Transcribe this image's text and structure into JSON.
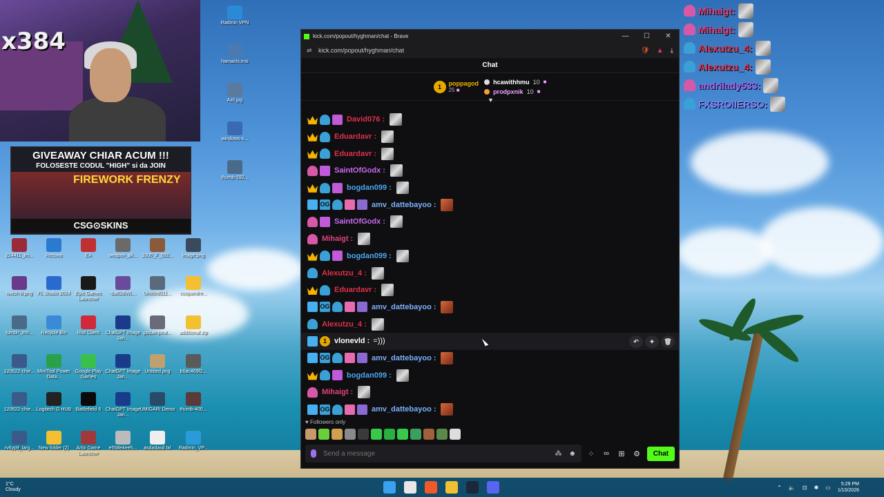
{
  "stream_overlay": {
    "counter": "x384",
    "giveaway_line1": "GIVEAWAY CHIAR ACUM !!!",
    "giveaway_line2": "FOLOSESTE CODUL \"HIGH\" si da JOIN",
    "giveaway_game": "FIREWORK FRENZY",
    "giveaway_sponsor": "CSG⊙SKINS",
    "chat": [
      {
        "user": "Mihaigt:",
        "color": "#e0407a"
      },
      {
        "user": "Mihaigt:",
        "color": "#e0407a"
      },
      {
        "user": "Alexutzu_4:",
        "color": "#e0304a"
      },
      {
        "user": "Alexutzu_4:",
        "color": "#e0304a"
      },
      {
        "user": "andrilady533:",
        "color": "#a060f0"
      },
      {
        "user": "FXSROIIERSO:",
        "color": "#8080ff"
      }
    ]
  },
  "desktop_icons": [
    {
      "label": "Radmin VPN"
    },
    {
      "label": "hamachi.msi"
    },
    {
      "label": "Azil.jpg"
    },
    {
      "label": "windows-x..."
    },
    {
      "label": "thumb-192..."
    },
    {
      "label": "224411_im..."
    },
    {
      "label": "Recuva"
    },
    {
      "label": "EA"
    },
    {
      "label": "weapon_ak..."
    },
    {
      "label": "1000_F_592..."
    },
    {
      "label": "image.png"
    },
    {
      "label": "twitch-b.png"
    },
    {
      "label": "FL Studio 2024"
    },
    {
      "label": "Epic Games Launcher"
    },
    {
      "label": "-9a81dlWL..."
    },
    {
      "label": "Untitled111..."
    },
    {
      "label": "coopandre..."
    },
    {
      "label": "tumblr_mrr..."
    },
    {
      "label": "Recycle Bin"
    },
    {
      "label": "Riot Client"
    },
    {
      "label": "ChatGPT Image Jan..."
    },
    {
      "label": "pozainjurat..."
    },
    {
      "label": "additional.zip"
    },
    {
      "label": "120622-chie..."
    },
    {
      "label": "MiniTool Power Data..."
    },
    {
      "label": "Google Play Games"
    },
    {
      "label": "ChatGPT Image Jan..."
    },
    {
      "label": "Untitled.png"
    },
    {
      "label": "b0ac469f2..."
    },
    {
      "label": "120622-chie..."
    },
    {
      "label": "Logitech G HUB"
    },
    {
      "label": "Battlefield 6"
    },
    {
      "label": "ChatGPT Image Jan..."
    },
    {
      "label": "UMIGARI Demo"
    },
    {
      "label": "thumb-400..."
    },
    {
      "label": "rv6yp9_larg..."
    },
    {
      "label": "New folder (2)"
    },
    {
      "label": "Artix Game Launcher"
    },
    {
      "label": "e558e4ee5..."
    },
    {
      "label": "asdadasd.txt"
    },
    {
      "label": "Radmin_VP..."
    }
  ],
  "browser": {
    "title": "kick.com/popout/hyghman/chat - Brave",
    "url": "kick.com/popout/hyghman/chat"
  },
  "chat": {
    "header": "Chat",
    "leaderboard": {
      "first": {
        "rank": "1",
        "name": "poppagod",
        "gifts": "25"
      },
      "others": [
        {
          "name": "hcawithhmu",
          "count": "10",
          "color": "#ffffff"
        },
        {
          "name": "prodpxnik",
          "count": "10",
          "color": "#f2a0ff"
        }
      ]
    },
    "messages": [
      {
        "user": "David076",
        "user_color": "#e0304a",
        "badges": [
          "crown",
          "bot",
          "gift"
        ],
        "emote": "cat",
        "text": ""
      },
      {
        "user": "Eduardavr",
        "user_color": "#e0304a",
        "badges": [
          "crown",
          "bot"
        ],
        "emote": "cat",
        "text": ""
      },
      {
        "user": "Eduardavr",
        "user_color": "#e0304a",
        "badges": [
          "crown",
          "bot"
        ],
        "emote": "cat",
        "text": ""
      },
      {
        "user": "SaintOfGodx",
        "user_color": "#c86af0",
        "badges": [
          "pinkmon",
          "gift"
        ],
        "emote": "cat",
        "text": ""
      },
      {
        "user": "bogdan099",
        "user_color": "#4aa8f0",
        "badges": [
          "crown",
          "bot",
          "gift"
        ],
        "emote": "cat",
        "text": ""
      },
      {
        "user": "amv_dattebayoo",
        "user_color": "#7ab0ff",
        "badges": [
          "tool",
          "og",
          "bot",
          "giftpink",
          "mod"
        ],
        "emote": "red",
        "text": ""
      },
      {
        "user": "SaintOfGodx",
        "user_color": "#c86af0",
        "badges": [
          "pinkmon",
          "gift"
        ],
        "emote": "cat",
        "text": ""
      },
      {
        "user": "Mihaigt",
        "user_color": "#e0407a",
        "badges": [
          "pinkmon"
        ],
        "emote": "cat",
        "text": ""
      },
      {
        "user": "bogdan099",
        "user_color": "#4aa8f0",
        "badges": [
          "crown",
          "bot",
          "gift"
        ],
        "emote": "cat",
        "text": ""
      },
      {
        "user": "Alexutzu_4",
        "user_color": "#e0304a",
        "badges": [
          "bot"
        ],
        "emote": "cat",
        "text": ""
      },
      {
        "user": "Eduardavr",
        "user_color": "#e0304a",
        "badges": [
          "crown",
          "bot"
        ],
        "emote": "cat",
        "text": ""
      },
      {
        "user": "amv_dattebayoo",
        "user_color": "#7ab0ff",
        "badges": [
          "tool",
          "og",
          "bot",
          "giftpink",
          "mod"
        ],
        "emote": "red",
        "text": ""
      },
      {
        "user": "Alexutzu_4",
        "user_color": "#e0304a",
        "badges": [
          "bot"
        ],
        "emote": "cat",
        "text": ""
      },
      {
        "user": "vlonevld",
        "user_color": "#ffffff",
        "badges": [
          "tool",
          "first"
        ],
        "emote": "",
        "text": "=)))"
      },
      {
        "user": "amv_dattebayoo",
        "user_color": "#7ab0ff",
        "badges": [
          "tool",
          "og",
          "bot",
          "giftpink",
          "mod"
        ],
        "emote": "red",
        "text": ""
      },
      {
        "user": "bogdan099",
        "user_color": "#4aa8f0",
        "badges": [
          "crown",
          "bot",
          "gift"
        ],
        "emote": "cat",
        "text": ""
      },
      {
        "user": "Mihaigt",
        "user_color": "#e0407a",
        "badges": [
          "pinkmon"
        ],
        "emote": "cat",
        "text": ""
      },
      {
        "user": "amv_dattebayoo",
        "user_color": "#7ab0ff",
        "badges": [
          "tool",
          "og",
          "bot",
          "giftpink",
          "mod"
        ],
        "emote": "red",
        "text": ""
      }
    ],
    "followers_only": "Followers only",
    "input_placeholder": "Send a message",
    "send_label": "Chat"
  },
  "taskbar": {
    "weather_temp": "1°C",
    "weather_text": "Cloudy",
    "time": "5:29 PM",
    "date": "1/10/2026"
  }
}
